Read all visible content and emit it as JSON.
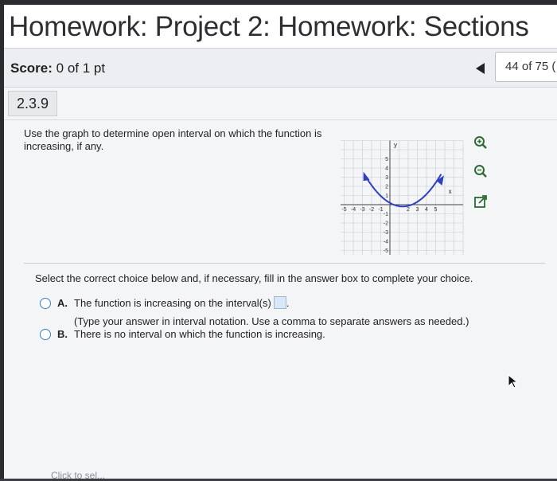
{
  "title": "Homework: Project 2: Homework: Sections",
  "score": {
    "label": "Score:",
    "value": "0 of 1 pt"
  },
  "navigation": {
    "counter": "44 of 75 ("
  },
  "question": {
    "number": "2.3.9",
    "text": "Use the graph to determine open interval on which the function is increasing, if any."
  },
  "graph": {
    "x_axis_label": "x",
    "y_axis_label": "y",
    "x_ticks": [
      "-5",
      "-4",
      "-3",
      "-2",
      "-1",
      "2",
      "3",
      "4",
      "5"
    ],
    "y_ticks": [
      "5",
      "4",
      "3",
      "2",
      "1",
      "-1",
      "-2",
      "-3",
      "-4",
      "-5"
    ],
    "curve_color": "#2f3fbf"
  },
  "instruction": "Select the correct choice below and, if necessary, fill in the answer box to complete your choice.",
  "choices": [
    {
      "letter": "A.",
      "text": "The function is increasing on the interval(s)"
    },
    {
      "letter": "B.",
      "text": "There is no interval on which the function is increasing."
    }
  ],
  "hint": "(Type your answer in interval notation. Use a comma to separate answers as needed.)",
  "footer_partial": "Click to sel..."
}
